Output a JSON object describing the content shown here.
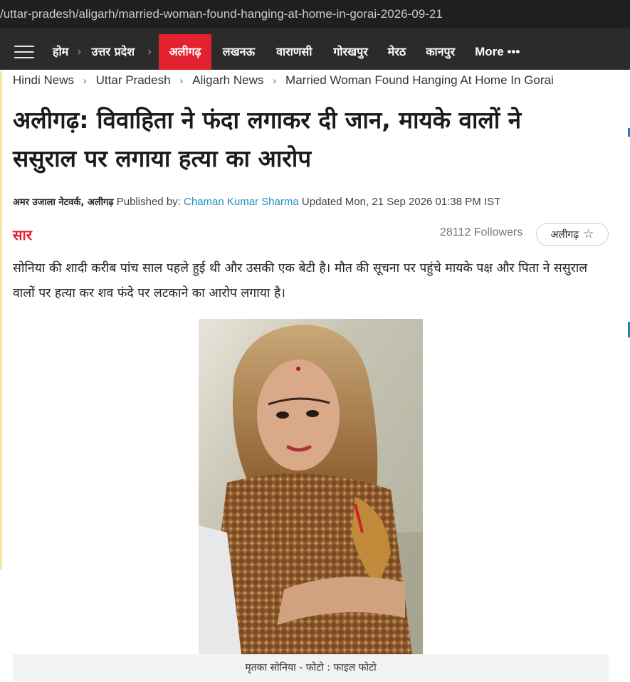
{
  "browser": {
    "url": "/uttar-pradesh/aligarh/married-woman-found-hanging-at-home-in-gorai-2026-09-21"
  },
  "nav": {
    "items": [
      {
        "label": "होम"
      },
      {
        "label": "उत्तर प्रदेश"
      },
      {
        "label": "अलीगढ़",
        "active": true
      },
      {
        "label": "लखनऊ"
      },
      {
        "label": "वाराणसी"
      },
      {
        "label": "गोरखपुर"
      },
      {
        "label": "मेरठ"
      },
      {
        "label": "कानपुर"
      }
    ],
    "more_label": "More •••",
    "active_color": "#e4212f",
    "bg_color": "#2b2b2b"
  },
  "breadcrumb": [
    {
      "label": "Hindi News"
    },
    {
      "label": "Uttar Pradesh"
    },
    {
      "label": "Aligarh News"
    },
    {
      "label": "Married Woman Found Hanging At Home In Gorai"
    }
  ],
  "article": {
    "title": "अलीगढ़: विवाहिता ने फंदा लगाकर दी जान, मायके वालों ने ससुराल पर लगाया हत्या का आरोप",
    "byline": {
      "network": "अमर उजाला नेटवर्क, अलीगढ़",
      "published_by_label": "Published by:",
      "author": "Chaman Kumar Sharma",
      "updated": "Updated Mon, 21 Sep 2026 01:38 PM IST"
    },
    "saar_label": "सार",
    "followers": "28112 Followers",
    "follow_tag": "अलीगढ़",
    "summary": "सोनिया की शादी करीब पांच साल पहले हुई थी और उसकी एक बेटी है। मौत की सूचना पर पहुंचे मायके पक्ष और पिता ने ससुराल वालों पर हत्या कर शव फंदे पर लटकाने का आरोप लगाया है।",
    "image_caption": "मृतका सोनिया  - फोटो : फाइल फोटो"
  },
  "icons": {
    "menu": "hamburger-icon",
    "star": "star-icon",
    "chevron": "chevron-right-icon"
  }
}
